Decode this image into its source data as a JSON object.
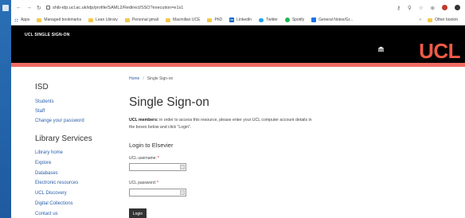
{
  "browser": {
    "back_icon": "arrow-left-icon",
    "forward_icon": "arrow-right-icon",
    "reload_icon": "reload-icon",
    "url": "shib-idp.ucl.ac.uk/idp/profile/SAML2/Redirect/SSO?execution=e1s1",
    "bookmarks": [
      {
        "label": "Apps",
        "icon": "apps-icon"
      },
      {
        "label": "Managed bookmarks",
        "icon": "folder-icon"
      },
      {
        "label": "Lean Library",
        "icon": "folder-icon"
      },
      {
        "label": "Personal gmail",
        "icon": "folder-icon"
      },
      {
        "label": "Macmillan UCE",
        "icon": "folder-icon"
      },
      {
        "label": "PhD",
        "icon": "folder-icon"
      },
      {
        "label": "LinkedIn",
        "icon": "linkedin-icon"
      },
      {
        "label": "Twitter",
        "icon": "twitter-icon"
      },
      {
        "label": "Spotify",
        "icon": "spotify-icon"
      },
      {
        "label": "General Notes/Gr...",
        "icon": "notes-icon"
      }
    ],
    "bookmarks_overflow": "»",
    "other_bookmarks": "Other bookm"
  },
  "header": {
    "title": "UCL SINGLE SIGN-ON",
    "logo": "UCL",
    "colors": {
      "bar": "#000000",
      "logo": "#f05a48",
      "band": "#ef6b63"
    }
  },
  "sidebar": {
    "isd_heading": "ISD",
    "isd_links": [
      "Students",
      "Staff",
      "Change your password"
    ],
    "library_heading": "Library Services",
    "library_links": [
      "Library home",
      "Explore",
      "Databases",
      "Electronic resources",
      "UCL Discovery",
      "Digital Collections",
      "Contact us"
    ]
  },
  "main": {
    "breadcrumb_home": "Home",
    "breadcrumb_sep": "/",
    "breadcrumb_current": "Single Sign-on",
    "title": "Single Sign-on",
    "intro_bold": "UCL members:",
    "intro_text": " in order to access this resource, please enter your UCL computer account details in the boxes below and click \"Login\".",
    "login_heading": "Login to Elsevier",
    "username_label": "UCL username:",
    "password_label": "UCL password:",
    "required_mark": "*",
    "login_button": "Login"
  }
}
